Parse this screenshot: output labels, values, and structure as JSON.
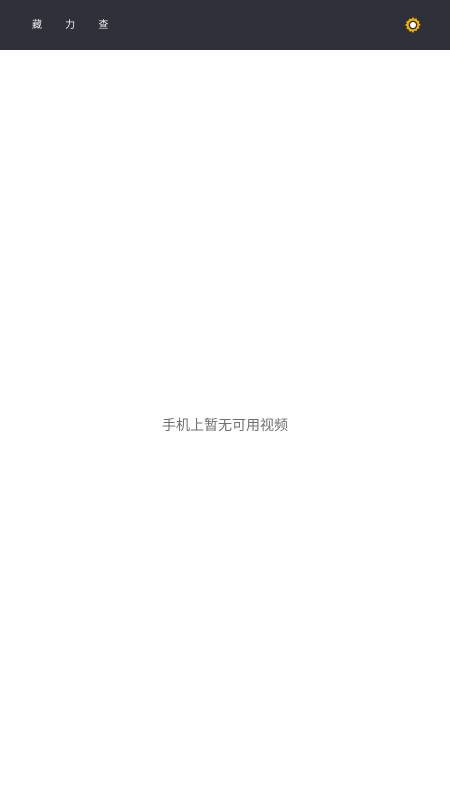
{
  "header": {
    "title": "藏 力 查",
    "settings_icon": "gear-icon",
    "background_color": "#2f303a",
    "accent_color": "#f4b400"
  },
  "main": {
    "empty_message": "手机上暂无可用视频"
  }
}
